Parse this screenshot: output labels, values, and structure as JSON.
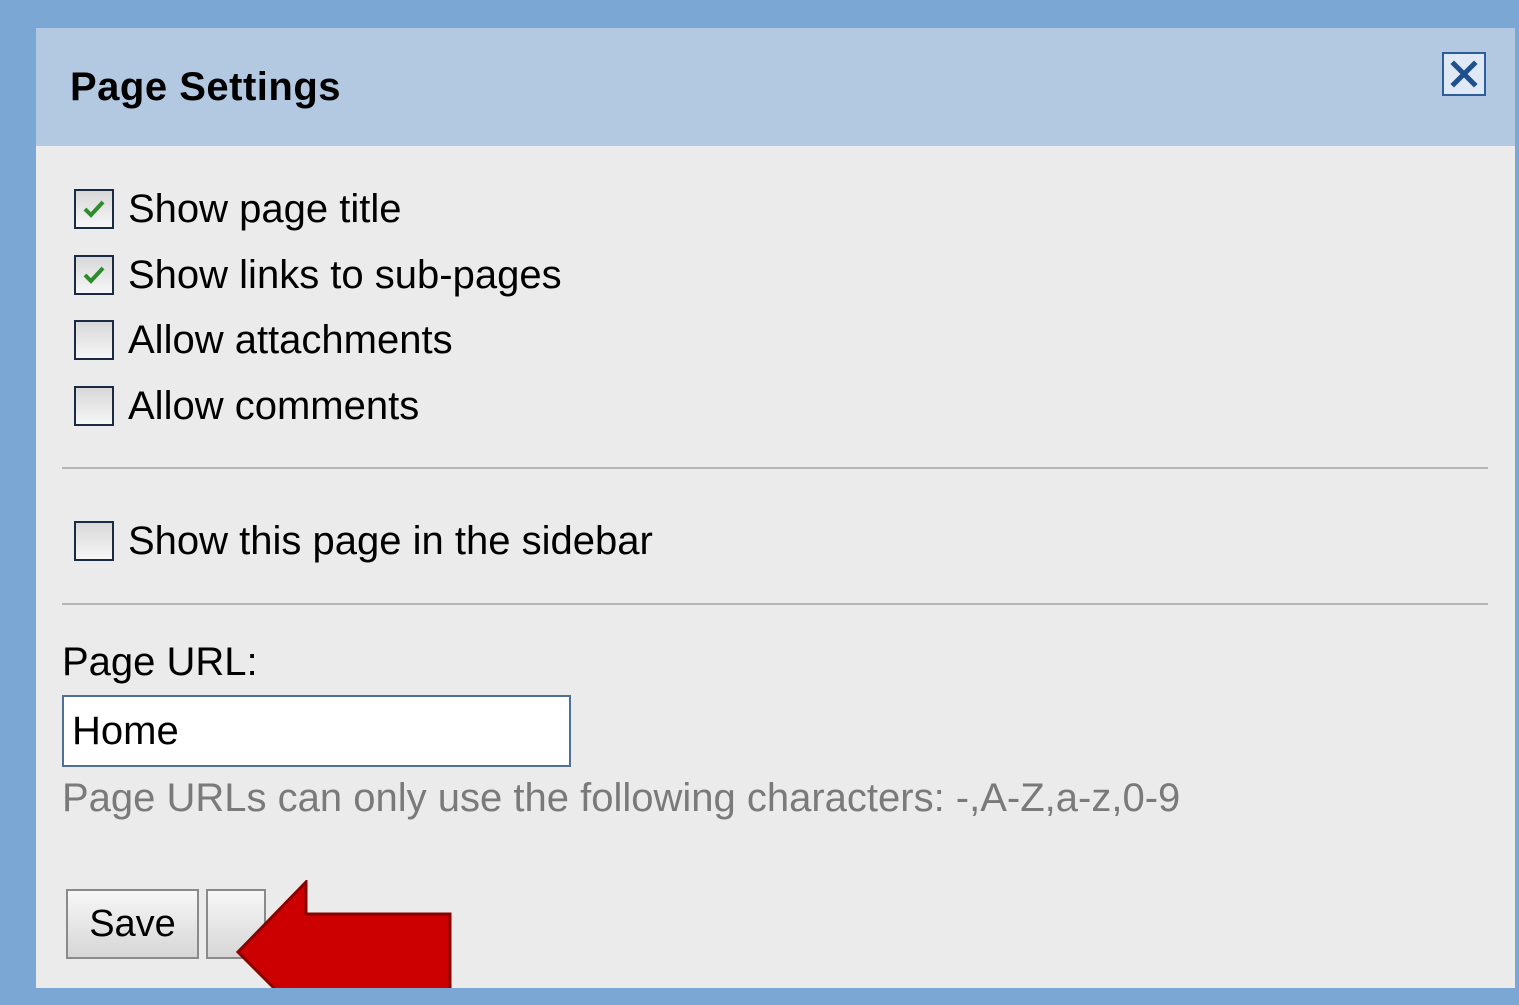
{
  "dialog": {
    "title": "Page Settings",
    "close_icon": "close-icon"
  },
  "options": [
    {
      "label": "Show page title",
      "checked": true
    },
    {
      "label": "Show links to sub-pages",
      "checked": true
    },
    {
      "label": "Allow attachments",
      "checked": false
    },
    {
      "label": "Allow comments",
      "checked": false
    }
  ],
  "sidebar_option": {
    "label": "Show this page in the sidebar",
    "checked": false
  },
  "url": {
    "label": "Page URL:",
    "value": "Home",
    "hint": "Page URLs can only use the following characters: -,A-Z,a-z,0-9"
  },
  "buttons": {
    "save_label": "Save"
  },
  "colors": {
    "window_frame": "#7aa7d3",
    "title_bar": "#b3c9e2",
    "dialog_bg": "#ebebeb",
    "check_mark": "#2e8b2e",
    "annotation_arrow": "#cc0000"
  },
  "annotation": {
    "icon": "red-arrow-icon",
    "points_to": "save-button"
  }
}
